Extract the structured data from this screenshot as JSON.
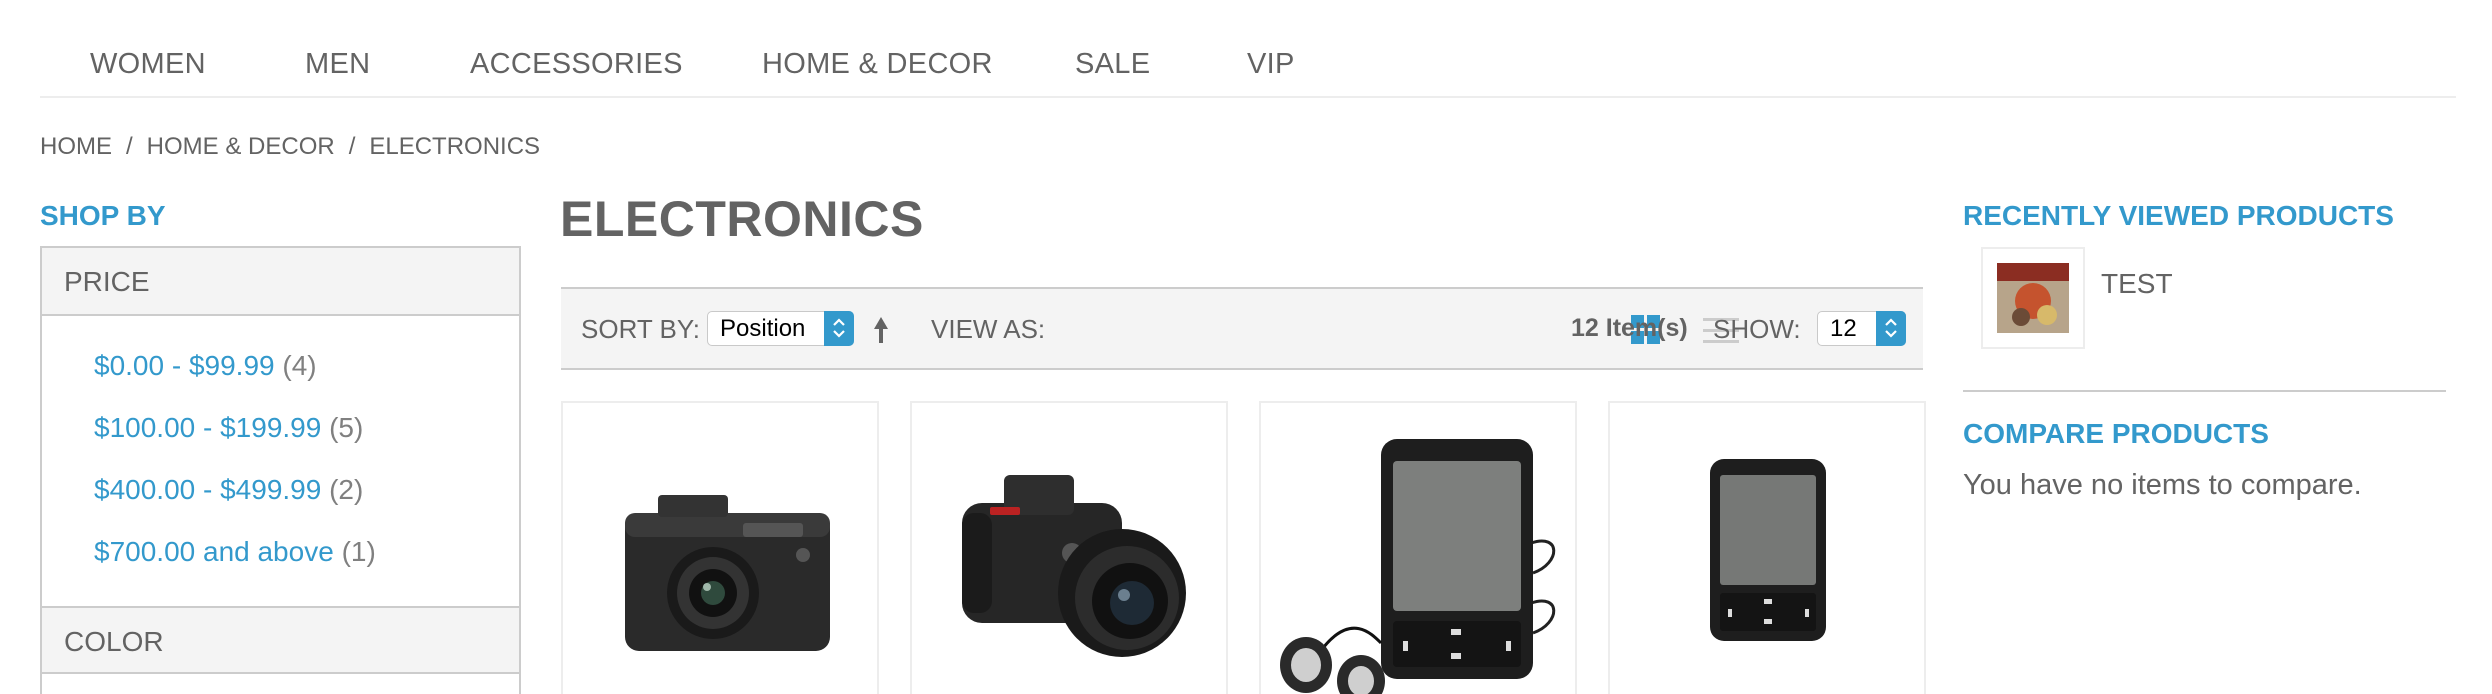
{
  "nav": {
    "items": [
      {
        "label": "WOMEN"
      },
      {
        "label": "MEN"
      },
      {
        "label": "ACCESSORIES"
      },
      {
        "label": "HOME & DECOR"
      },
      {
        "label": "SALE"
      },
      {
        "label": "VIP"
      }
    ]
  },
  "breadcrumb": {
    "items": [
      "HOME",
      "HOME & DECOR",
      "ELECTRONICS"
    ],
    "separator": "/"
  },
  "sidebar": {
    "title": "SHOP BY",
    "filters": [
      {
        "label": "PRICE",
        "options": [
          {
            "range": "$0.00 - $99.99",
            "count": "(4)"
          },
          {
            "range": "$100.00 - $199.99",
            "count": "(5)"
          },
          {
            "range": "$400.00 - $499.99",
            "count": "(2)"
          },
          {
            "range": "$700.00 and above",
            "count": "(1)"
          }
        ]
      },
      {
        "label": "COLOR"
      }
    ]
  },
  "main": {
    "title": "ELECTRONICS",
    "toolbar": {
      "sort_label": "SORT BY:",
      "sort_value": "Position",
      "view_label": "VIEW AS:",
      "view_mode": "grid",
      "item_count": "12 Item(s)",
      "show_label": "SHOW:",
      "show_value": "12"
    },
    "products": [
      {
        "image": "compact-camera-image"
      },
      {
        "image": "dslr-camera-image"
      },
      {
        "image": "media-player-with-earbuds-image"
      },
      {
        "image": "media-player-image"
      }
    ]
  },
  "right": {
    "recently_viewed_title": "RECENTLY VIEWED PRODUCTS",
    "recent_items": [
      {
        "name": "TEST"
      }
    ],
    "compare_title": "COMPARE PRODUCTS",
    "compare_empty": "You have no items to compare."
  },
  "colors": {
    "accent": "#3399cc",
    "text": "#636363",
    "border": "#cccccc",
    "panel": "#f4f4f4"
  }
}
